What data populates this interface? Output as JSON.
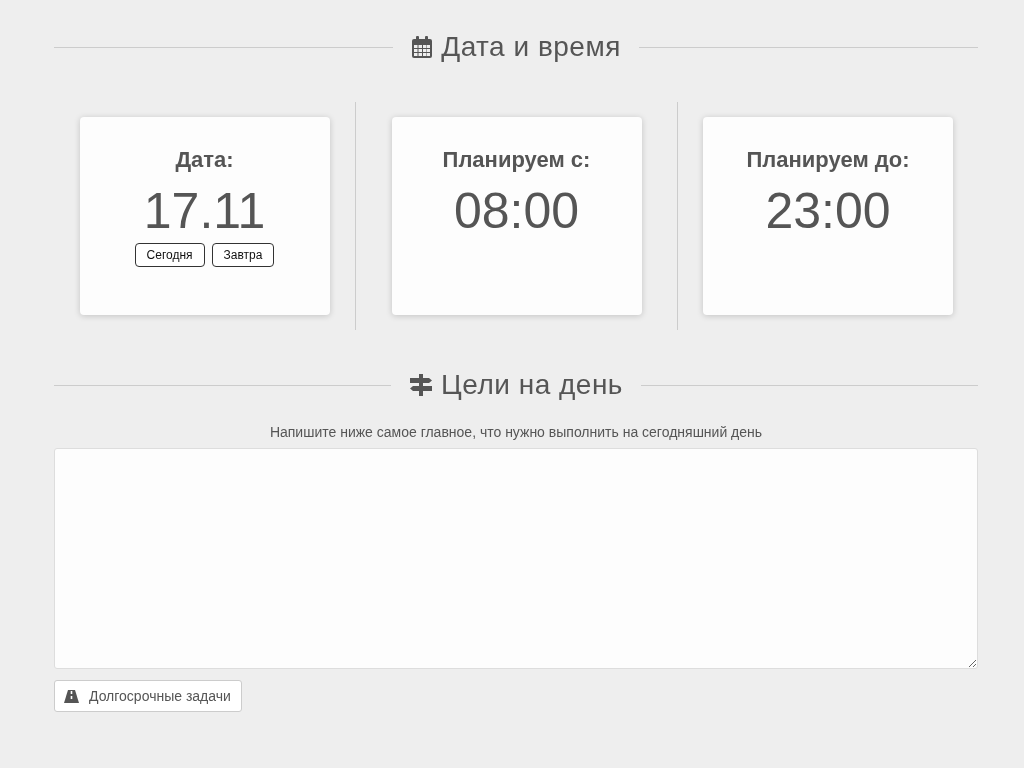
{
  "date_section": {
    "title": "Дата и время",
    "cards": [
      {
        "kind": "date",
        "label": "Дата:",
        "value": "17.11",
        "buttons": [
          "Сегодня",
          "Завтра"
        ]
      },
      {
        "kind": "time",
        "label": "Планируем с:",
        "value": "08:00"
      },
      {
        "kind": "time",
        "label": "Планируем до:",
        "value": "23:00"
      }
    ]
  },
  "goals_section": {
    "title": "Цели на день",
    "hint": "Напишите ниже самое главное, что нужно выполнить на сегодняшний день",
    "button": "Долгосрочные задачи"
  }
}
